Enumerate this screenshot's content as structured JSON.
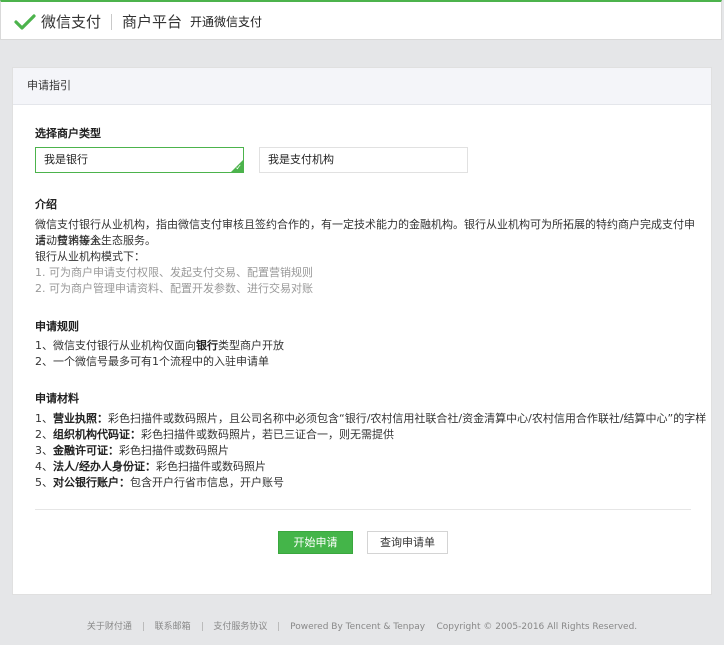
{
  "header": {
    "brand_name": "微信支付",
    "platform": "商户平台",
    "open_link": "开通微信支付",
    "brand_color": "#4cb34c"
  },
  "card": {
    "title": "申请指引",
    "select_type": {
      "heading": "选择商户类型",
      "options": [
        {
          "label": "我是银行",
          "selected": true
        },
        {
          "label": "我是支付机构",
          "selected": false
        }
      ]
    },
    "intro": {
      "heading": "介绍",
      "line1": "微信支付银行从业机构，指由微信支付审核且签约合作的，有一定技术能力的金融机构。银行从业机构可为所拓展的特约商户完成支付申请、技术接入、",
      "line2": "活动营销等全生态服务。",
      "mode_title": "银行从业机构模式下：",
      "modes": [
        "1. 可为商户申请支付权限、发起支付交易、配置营销规则",
        "2. 可为商户管理申请资料、配置开发参数、进行交易对账"
      ]
    },
    "rules": {
      "heading": "申请规则",
      "rule1_pre": "1、微信支付银行从业机构仅面向",
      "rule1_bold": "银行",
      "rule1_post": "类型商户开放",
      "rule2": "2、一个微信号最多可有1个流程中的入驻申请单"
    },
    "materials": {
      "heading": "申请材料",
      "items": [
        {
          "num": "1、",
          "name": "营业执照：",
          "desc": "彩色扫描件或数码照片，且公司名称中必须包含“银行/农村信用社联合社/资金清算中心/农村信用合作联社/结算中心”的字样"
        },
        {
          "num": "2、",
          "name": "组织机构代码证：",
          "desc": "彩色扫描件或数码照片，若已三证合一，则无需提供"
        },
        {
          "num": "3、",
          "name": "金融许可证：",
          "desc": "彩色扫描件或数码照片"
        },
        {
          "num": "4、",
          "name": "法人/经办人身份证：",
          "desc": "彩色扫描件或数码照片"
        },
        {
          "num": "5、",
          "name": "对公银行账户：",
          "desc": "包含开户行省市信息，开户账号"
        }
      ]
    },
    "buttons": {
      "start": "开始申请",
      "query": "查询申请单"
    }
  },
  "footer": {
    "links": [
      "关于财付通",
      "联系邮箱",
      "支付服务协议"
    ],
    "powered": "Powered By Tencent & Tenpay",
    "copyright": "Copyright © 2005-2016 All Rights Reserved."
  }
}
